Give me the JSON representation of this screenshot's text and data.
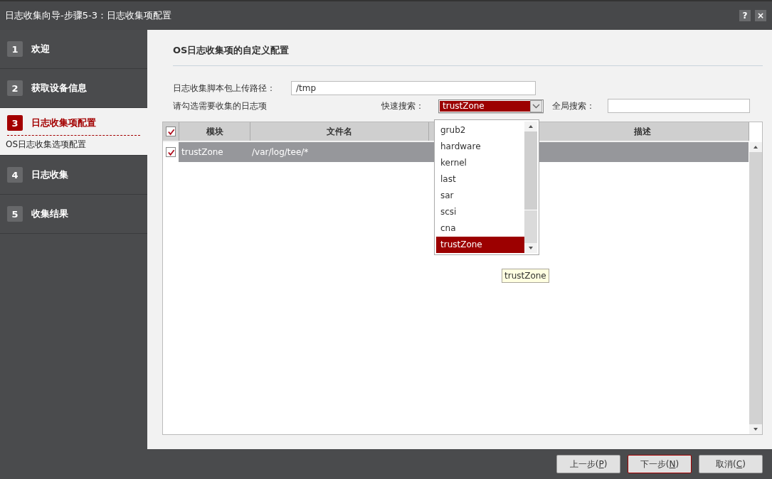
{
  "window": {
    "title": "日志收集向导-步骤5-3：日志收集项配置",
    "help_button": "?",
    "close_button": "×"
  },
  "steps": [
    {
      "number": "1",
      "label": "欢迎",
      "selected": false
    },
    {
      "number": "2",
      "label": "获取设备信息",
      "selected": false
    },
    {
      "number": "3",
      "label": "日志收集项配置",
      "selected": true,
      "sub_items": [
        "OS日志收集选项配置"
      ]
    },
    {
      "number": "4",
      "label": "日志收集",
      "selected": false
    },
    {
      "number": "5",
      "label": "收集结果",
      "selected": false
    }
  ],
  "heading": "OS日志收集项的自定义配置",
  "upload_path": {
    "label": "日志收集脚本包上传路径：",
    "value": "/tmp"
  },
  "instruction": "请勾选需要收集的日志项",
  "quick_search": {
    "label": "快速搜索：",
    "value": "trustZone",
    "expanded": true,
    "options": [
      {
        "label": "grub2",
        "selected": false
      },
      {
        "label": "hardware",
        "selected": false
      },
      {
        "label": "kernel",
        "selected": false
      },
      {
        "label": "last",
        "selected": false
      },
      {
        "label": "sar",
        "selected": false
      },
      {
        "label": "scsi",
        "selected": false
      },
      {
        "label": "cna",
        "selected": false
      },
      {
        "label": "trustZone",
        "selected": true
      }
    ]
  },
  "global_search": {
    "label": "全局搜索："
  },
  "table": {
    "all_checked": true,
    "columns": [
      "模块",
      "文件名",
      "描述"
    ],
    "rows": [
      {
        "checked": true,
        "selected": true,
        "module": "trustZone",
        "file": "/var/log/tee/*"
      }
    ]
  },
  "tooltip": "trustZone",
  "buttons": [
    {
      "before": "上一步(",
      "key": "P",
      "after": ")",
      "default": false
    },
    {
      "before": "下一步(",
      "key": "N",
      "after": ")",
      "default": true
    },
    {
      "before": "取消(",
      "key": "C",
      "after": ")",
      "default": false
    }
  ]
}
